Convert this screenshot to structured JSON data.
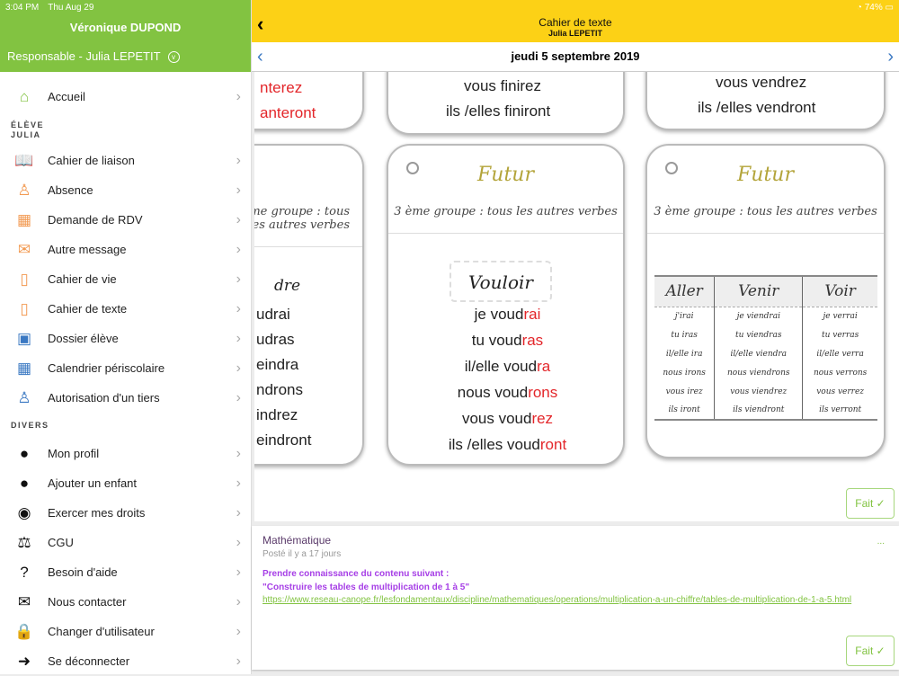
{
  "status": {
    "time": "3:04 PM",
    "date": "Thu Aug 29",
    "battery": "74%"
  },
  "sidebar": {
    "user": "Véronique DUPOND",
    "role": "Responsable - Julia LEPETIT",
    "home": "Accueil",
    "section_eleve": "ÉLÈVE",
    "section_student": "JULIA",
    "eleve_items": [
      {
        "label": "Cahier de liaison",
        "icon": "book-icon"
      },
      {
        "label": "Absence",
        "icon": "person-absent-icon"
      },
      {
        "label": "Demande de RDV",
        "icon": "calendar-add-icon"
      },
      {
        "label": "Autre message",
        "icon": "envelope-icon"
      },
      {
        "label": "Cahier de vie",
        "icon": "notebook-icon"
      },
      {
        "label": "Cahier de texte",
        "icon": "notepad-icon"
      },
      {
        "label": "Dossier élève",
        "icon": "id-card-icon"
      },
      {
        "label": "Calendrier périscolaire",
        "icon": "calendar-31-icon"
      },
      {
        "label": "Autorisation d'un tiers",
        "icon": "person-question-icon"
      }
    ],
    "section_divers": "DIVERS",
    "divers_items": [
      {
        "label": "Mon profil",
        "icon": "user-icon"
      },
      {
        "label": "Ajouter un enfant",
        "icon": "add-child-icon"
      },
      {
        "label": "Exercer mes droits",
        "icon": "eye-icon"
      },
      {
        "label": "CGU",
        "icon": "scales-icon"
      },
      {
        "label": "Besoin d'aide",
        "icon": "help-icon"
      },
      {
        "label": "Nous contacter",
        "icon": "mail-icon"
      },
      {
        "label": "Changer d'utilisateur",
        "icon": "lock-icon"
      },
      {
        "label": "Se déconnecter",
        "icon": "logout-icon"
      }
    ]
  },
  "header": {
    "title": "Cahier de texte",
    "subtitle": "Julia LEPETIT",
    "date": "jeudi 5 septembre 2019"
  },
  "image": {
    "top_left": [
      "nterez",
      "anteront"
    ],
    "top_mid": [
      "vous finirez",
      "ils /elles finiront"
    ],
    "top_right": [
      "vous vendrez",
      "ils /elles vendront"
    ],
    "futur": "Futur",
    "group": "3 ème groupe : tous les autres verbes",
    "left_header": "dre",
    "left_lines": [
      "udrai",
      "udras",
      "eindra",
      "ndrons",
      "indrez",
      "eindront"
    ],
    "mid_verb": "Vouloir",
    "mid_lines": [
      [
        "je voud",
        "rai"
      ],
      [
        "tu voud",
        "ras"
      ],
      [
        "il/elle voud",
        "ra"
      ],
      [
        "nous voud",
        "rons"
      ],
      [
        "vous voud",
        "rez"
      ],
      [
        "ils /elles voud",
        "ront"
      ]
    ],
    "table_headers": [
      "Aller",
      "Venir",
      "Voir"
    ],
    "table_rows": [
      [
        "j'irai",
        "je viendrai",
        "je verrai"
      ],
      [
        "tu iras",
        "tu viendras",
        "tu verras"
      ],
      [
        "il/elle ira",
        "il/elle viendra",
        "il/elle verra"
      ],
      [
        "nous irons",
        "nous viendrons",
        "nous verrons"
      ],
      [
        "vous irez",
        "vous viendrez",
        "vous verrez"
      ],
      [
        "ils iront",
        "ils viendront",
        "ils verront"
      ]
    ]
  },
  "done_label": "Fait ✓",
  "homework": {
    "subject": "Mathématique",
    "posted": "Posté il y a 17 jours",
    "line1": "Prendre connaissance du contenu suivant :",
    "line2": "\"Construire les tables de multiplication de 1 à 5\"",
    "link": "https://www.reseau-canope.fr/lesfondamentaux/discipline/mathematiques/operations/multiplication-a-un-chiffre/tables-de-multiplication-de-1-a-5.html",
    "more": "..."
  }
}
